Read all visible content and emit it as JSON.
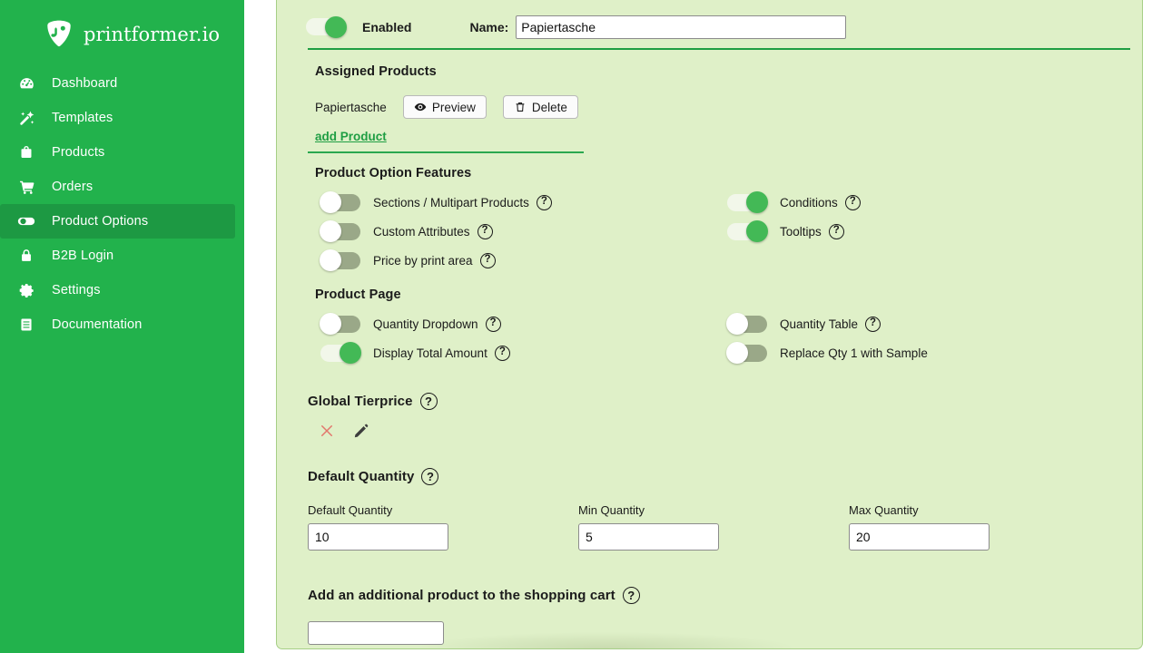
{
  "brand": {
    "name": "printformer.io",
    "logo_icon": "printformer-logo-icon"
  },
  "sidebar": {
    "items": [
      {
        "label": "Dashboard",
        "icon": "dashboard-icon",
        "active": false
      },
      {
        "label": "Templates",
        "icon": "magic-wand-icon",
        "active": false
      },
      {
        "label": "Products",
        "icon": "shopping-bag-icon",
        "active": false
      },
      {
        "label": "Orders",
        "icon": "shopping-cart-icon",
        "active": false
      },
      {
        "label": "Product Options",
        "icon": "toggle-icon",
        "active": true
      },
      {
        "label": "B2B Login",
        "icon": "lock-icon",
        "active": false
      },
      {
        "label": "Settings",
        "icon": "gear-icon",
        "active": false
      },
      {
        "label": "Documentation",
        "icon": "document-icon",
        "active": false
      }
    ]
  },
  "header": {
    "enabled_label": "Enabled",
    "enabled_state": "on",
    "name_label": "Name:",
    "name_value": "Papiertasche",
    "name_placeholder": ""
  },
  "assigned_products": {
    "title": "Assigned Products",
    "rows": [
      {
        "name": "Papiertasche",
        "preview_label": "Preview",
        "preview_icon": "eye-icon",
        "delete_label": "Delete",
        "delete_icon": "trash-icon"
      }
    ],
    "add_link": "add Product"
  },
  "product_option_features": {
    "title": "Product Option Features",
    "left": [
      {
        "label": "Sections / Multipart Products",
        "state": "off",
        "help": true
      },
      {
        "label": "Custom Attributes",
        "state": "off",
        "help": true
      },
      {
        "label": "Price by print area",
        "state": "off",
        "help": true
      }
    ],
    "right": [
      {
        "label": "Conditions",
        "state": "on",
        "help": true
      },
      {
        "label": "Tooltips",
        "state": "on",
        "help": true
      }
    ]
  },
  "product_page": {
    "title": "Product Page",
    "left": [
      {
        "label": "Quantity Dropdown",
        "state": "off",
        "help": true
      },
      {
        "label": "Display Total Amount",
        "state": "on",
        "help": true
      }
    ],
    "right": [
      {
        "label": "Quantity Table",
        "state": "off",
        "help": true
      },
      {
        "label": "Replace Qty 1 with Sample",
        "state": "off",
        "help": false
      }
    ]
  },
  "global_tierprice": {
    "title": "Global Tierprice",
    "help": "?",
    "delete_icon": "x-close-icon",
    "edit_icon": "pencil-icon"
  },
  "default_quantity": {
    "title": "Default Quantity",
    "help": "?",
    "fields": [
      {
        "label": "Default Quantity",
        "value": "10"
      },
      {
        "label": "Min Quantity",
        "value": "5"
      },
      {
        "label": "Max Quantity",
        "value": "20"
      }
    ]
  },
  "additional_product": {
    "title": "Add an additional product to the shopping cart",
    "help": "?",
    "value": "",
    "placeholder": ""
  },
  "glyphs": {
    "help": "?"
  },
  "colors": {
    "sidebar_green": "#22b24c",
    "sidebar_active_green": "#1d9943",
    "panel_bg": "#dff0c8",
    "panel_border": "#a6cf86",
    "divider_green": "#1f9e43",
    "link_green": "#1f9e43",
    "toggle_on_knob": "#43b956",
    "toggle_off_track": "#9aa888",
    "delete_x_red": "#e2776c"
  }
}
